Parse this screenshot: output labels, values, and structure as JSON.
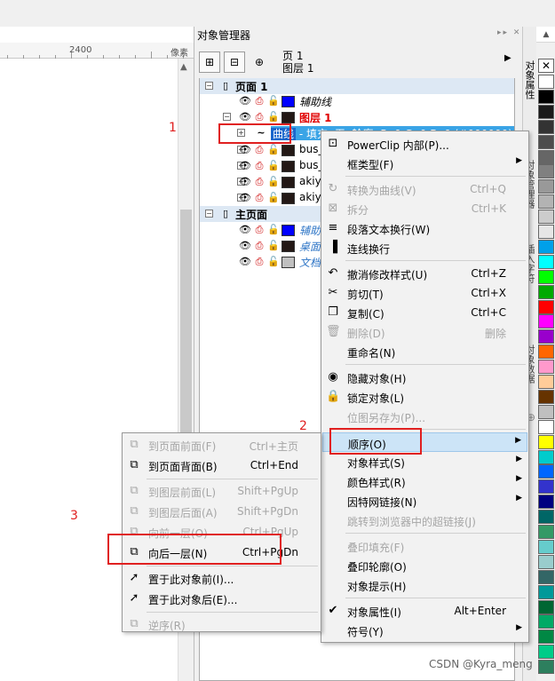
{
  "ruler": {
    "label": "2400",
    "units": "像素"
  },
  "docker": {
    "title": "对象管理器",
    "controls": "▸▸ ✕",
    "page": "页 1",
    "layer": "图层 1",
    "toolbar": [
      "⊞",
      "⊟",
      "⊕"
    ]
  },
  "tree": {
    "rows": [
      {
        "level": 0,
        "exp": "⊟",
        "label": "页面 1",
        "bold": true,
        "header": true
      },
      {
        "level": 2,
        "label": "辅助线",
        "italic": true,
        "color": "#000000",
        "swatch": "#0000ff"
      },
      {
        "level": 1,
        "exp": "⊟",
        "label": "图层 1",
        "bold": true,
        "color": "#e00000",
        "swatch": "#231815"
      },
      {
        "level": 2,
        "exp": "⊞",
        "label": "曲线",
        "suffix": " - 填充: 无, 轮廓: R: 0 G: 0 B: 0 (#000000) 2...",
        "selected": true
      },
      {
        "level": 2,
        "exp": "⊞",
        "label": "bus_",
        "swatch": "#231815"
      },
      {
        "level": 2,
        "exp": "⊞",
        "label": "bus_",
        "swatch": "#231815"
      },
      {
        "level": 2,
        "exp": "⊞",
        "label": "akiy",
        "swatch": "#231815"
      },
      {
        "level": 2,
        "exp": "⊞",
        "label": "akiy",
        "swatch": "#231815"
      },
      {
        "level": 0,
        "exp": "⊟",
        "label": "主页面",
        "bold": true,
        "header": true
      },
      {
        "level": 2,
        "label": "辅助",
        "italic": true,
        "color": "#2e75c6",
        "swatch": "#0000ff"
      },
      {
        "level": 2,
        "label": "桌面",
        "italic": true,
        "color": "#2e75c6",
        "swatch": "#231815"
      },
      {
        "level": 2,
        "label": "文档",
        "italic": true,
        "color": "#2e75c6",
        "swatch": "#c0c0c0"
      }
    ]
  },
  "vtabs": [
    "对象属性",
    "对象管理器",
    "插入字符",
    "对象数据"
  ],
  "palette": [
    "#ffffff",
    "#000000",
    "#1a1a1a",
    "#333333",
    "#4d4d4d",
    "#666666",
    "#808080",
    "#999999",
    "#b3b3b3",
    "#cccccc",
    "#e6e6e6",
    "#00a0e9",
    "#00ffff",
    "#00ff00",
    "#00aa00",
    "#ff0000",
    "#ff00ff",
    "#9900cc",
    "#ff6600",
    "#ff99cc",
    "#ffcc99",
    "#663300",
    "#c0c0c0",
    "#ffffff",
    "#ffff00",
    "#00cccc",
    "#0066ff",
    "#3333cc",
    "#000080",
    "#006666",
    "#339966",
    "#66cccc",
    "#99cccc",
    "#336666",
    "#009999",
    "#006633",
    "#00aa66",
    "#008844",
    "#00cc88",
    "#2d7f5e",
    "#004d33",
    "#1a6644"
  ],
  "context_menu": {
    "items": [
      {
        "label": "PowerClip 内部(P)...",
        "icon": "powerclip-icon",
        "glyph": "⊡"
      },
      {
        "label": "框类型(F)",
        "arrow": true
      },
      {
        "sep": true
      },
      {
        "label": "转换为曲线(V)",
        "key": "Ctrl+Q",
        "disabled": true,
        "icon": "convert-curve-icon",
        "glyph": "↻"
      },
      {
        "label": "拆分",
        "key": "Ctrl+K",
        "disabled": true,
        "icon": "break-apart-icon",
        "glyph": "⊠"
      },
      {
        "label": "段落文本换行(W)",
        "icon": "wrap-text-icon",
        "glyph": "≡"
      },
      {
        "label": "连线换行",
        "icon": "line-wrap-icon",
        "glyph": "▐"
      },
      {
        "sep": true
      },
      {
        "label": "撤消修改样式(U)",
        "key": "Ctrl+Z",
        "icon": "undo-icon",
        "glyph": "↶"
      },
      {
        "label": "剪切(T)",
        "key": "Ctrl+X",
        "icon": "cut-icon",
        "glyph": "✂"
      },
      {
        "label": "复制(C)",
        "key": "Ctrl+C",
        "icon": "copy-icon",
        "glyph": "❐"
      },
      {
        "label": "删除(D)",
        "key": "删除",
        "disabled": true,
        "icon": "delete-icon",
        "glyph": "🗑"
      },
      {
        "label": "重命名(N)"
      },
      {
        "sep": true
      },
      {
        "label": "隐藏对象(H)",
        "icon": "hide-icon",
        "glyph": "◉"
      },
      {
        "label": "锁定对象(L)",
        "icon": "lock-icon",
        "glyph": "🔒"
      },
      {
        "label": "位图另存为(P)...",
        "disabled": true
      },
      {
        "sep": true
      },
      {
        "label": "顺序(O)",
        "arrow": true,
        "highlight": true
      },
      {
        "label": "对象样式(S)",
        "arrow": true
      },
      {
        "label": "颜色样式(R)",
        "arrow": true
      },
      {
        "label": "因特网链接(N)",
        "arrow": true
      },
      {
        "label": "跳转到浏览器中的超链接(J)",
        "disabled": true
      },
      {
        "sep": true
      },
      {
        "label": "叠印填充(F)",
        "disabled": true
      },
      {
        "label": "叠印轮廓(O)"
      },
      {
        "label": "对象提示(H)"
      },
      {
        "sep": true
      },
      {
        "label": "对象属性(I)",
        "key": "Alt+Enter",
        "check": true
      },
      {
        "label": "符号(Y)",
        "arrow": true
      }
    ]
  },
  "submenu": {
    "items": [
      {
        "label": "到页面前面(F)",
        "key": "Ctrl+主页",
        "disabled": true,
        "icon": "to-page-front-icon",
        "glyph": "⧉"
      },
      {
        "label": "到页面背面(B)",
        "key": "Ctrl+End",
        "icon": "to-page-back-icon",
        "glyph": "⧉"
      },
      {
        "sep": true
      },
      {
        "label": "到图层前面(L)",
        "key": "Shift+PgUp",
        "disabled": true,
        "icon": "to-layer-front-icon",
        "glyph": "⧉"
      },
      {
        "label": "到图层后面(A)",
        "key": "Shift+PgDn",
        "disabled": true,
        "icon": "to-layer-back-icon",
        "glyph": "⧉"
      },
      {
        "label": "向前一层(O)",
        "key": "Ctrl+PgUp",
        "disabled": true,
        "icon": "forward-one-icon",
        "glyph": "⧉"
      },
      {
        "label": "向后一层(N)",
        "key": "Ctrl+PgDn",
        "icon": "back-one-icon",
        "glyph": "⧉"
      },
      {
        "sep": true
      },
      {
        "label": "置于此对象前(I)...",
        "icon": "in-front-of-icon",
        "glyph": "➚"
      },
      {
        "label": "置于此对象后(E)...",
        "icon": "behind-icon",
        "glyph": "➚"
      },
      {
        "sep": true
      },
      {
        "label": "逆序(R)",
        "disabled": true,
        "icon": "reverse-order-icon",
        "glyph": "⧉"
      }
    ]
  },
  "annotations": [
    "1",
    "2",
    "3"
  ],
  "watermark": "CSDN @Kyra_meng"
}
